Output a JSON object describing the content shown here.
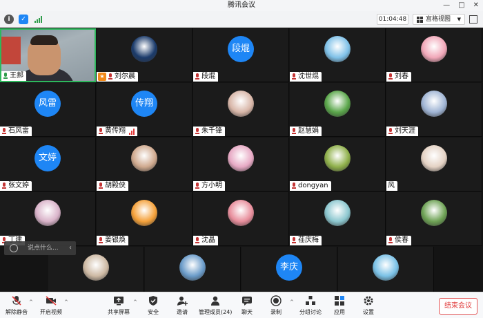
{
  "window": {
    "title": "腾讯会议"
  },
  "topbar": {
    "timer": "01:04:48",
    "view_label": "宫格视图"
  },
  "participants": [
    {
      "name": "王郝",
      "type": "video",
      "mic": "on"
    },
    {
      "name": "刘尔晨",
      "type": "photo",
      "host": true,
      "mic": "off",
      "color": "#1b3b6b"
    },
    {
      "name": "段焜",
      "type": "text",
      "initials": "段焜",
      "mic": "off"
    },
    {
      "name": "沈世焜",
      "type": "photo",
      "mic": "off",
      "color": "#7fc1e8"
    },
    {
      "name": "刘春",
      "type": "photo",
      "mic": "off",
      "color": "#f1a7b8"
    },
    {
      "name": "石风雷",
      "type": "text",
      "initials": "风雷",
      "mic": "off"
    },
    {
      "name": "黄传翔",
      "type": "text",
      "initials": "传翔",
      "mic": "off",
      "signal": true
    },
    {
      "name": "朱千锋",
      "type": "photo",
      "mic": "off",
      "color": "#d8b6a8"
    },
    {
      "name": "赵慧娟",
      "type": "photo",
      "mic": "off",
      "color": "#5aa64a"
    },
    {
      "name": "刘天涯",
      "type": "photo",
      "mic": "off",
      "color": "#9fb4d4"
    },
    {
      "name": "张文婷",
      "type": "text",
      "initials": "文婷",
      "mic": "off"
    },
    {
      "name": "胡殿侠",
      "type": "photo",
      "mic": "off",
      "color": "#cfa98e"
    },
    {
      "name": "方小明",
      "type": "photo",
      "mic": "off",
      "color": "#e7a9c4"
    },
    {
      "name": "dongyan",
      "type": "photo",
      "mic": "off",
      "color": "#8fb04a"
    },
    {
      "name": "风",
      "type": "photo",
      "mic": "none",
      "color": "#e4d2c4"
    },
    {
      "name": "丁建",
      "type": "photo",
      "mic": "off",
      "color": "#d9b3c9"
    },
    {
      "name": "姜银焕",
      "type": "photo",
      "mic": "off",
      "color": "#f5a13a"
    },
    {
      "name": "沈晶",
      "type": "photo",
      "mic": "off",
      "color": "#e88e9c"
    },
    {
      "name": "荏庆梅",
      "type": "photo",
      "mic": "off",
      "color": "#8cc7cf"
    },
    {
      "name": "侯春",
      "type": "photo",
      "mic": "off",
      "color": "#6ea255"
    },
    {
      "name": "",
      "type": "photo",
      "mic": "none",
      "color": "#cdb9a3"
    },
    {
      "name": "",
      "type": "photo",
      "mic": "none",
      "color": "#6a9bc9"
    },
    {
      "name": "",
      "type": "text",
      "initials": "李庆",
      "mic": "none"
    },
    {
      "name": "",
      "type": "photo",
      "mic": "none",
      "color": "#7ac1e6"
    }
  ],
  "chat": {
    "placeholder": "说点什么..."
  },
  "toolbar": {
    "mute": "解除静音",
    "video": "开启视频",
    "share": "共享屏幕",
    "security": "安全",
    "invite": "邀请",
    "members": "管理成员(24)",
    "chat": "聊天",
    "record": "录制",
    "breakout": "分组讨论",
    "apps": "应用",
    "settings": "设置",
    "end": "结束会议"
  },
  "colors": {
    "avatar_text_bg": "#1e86f5",
    "active_border": "#2eb85c",
    "end_red": "#e03b3b"
  }
}
